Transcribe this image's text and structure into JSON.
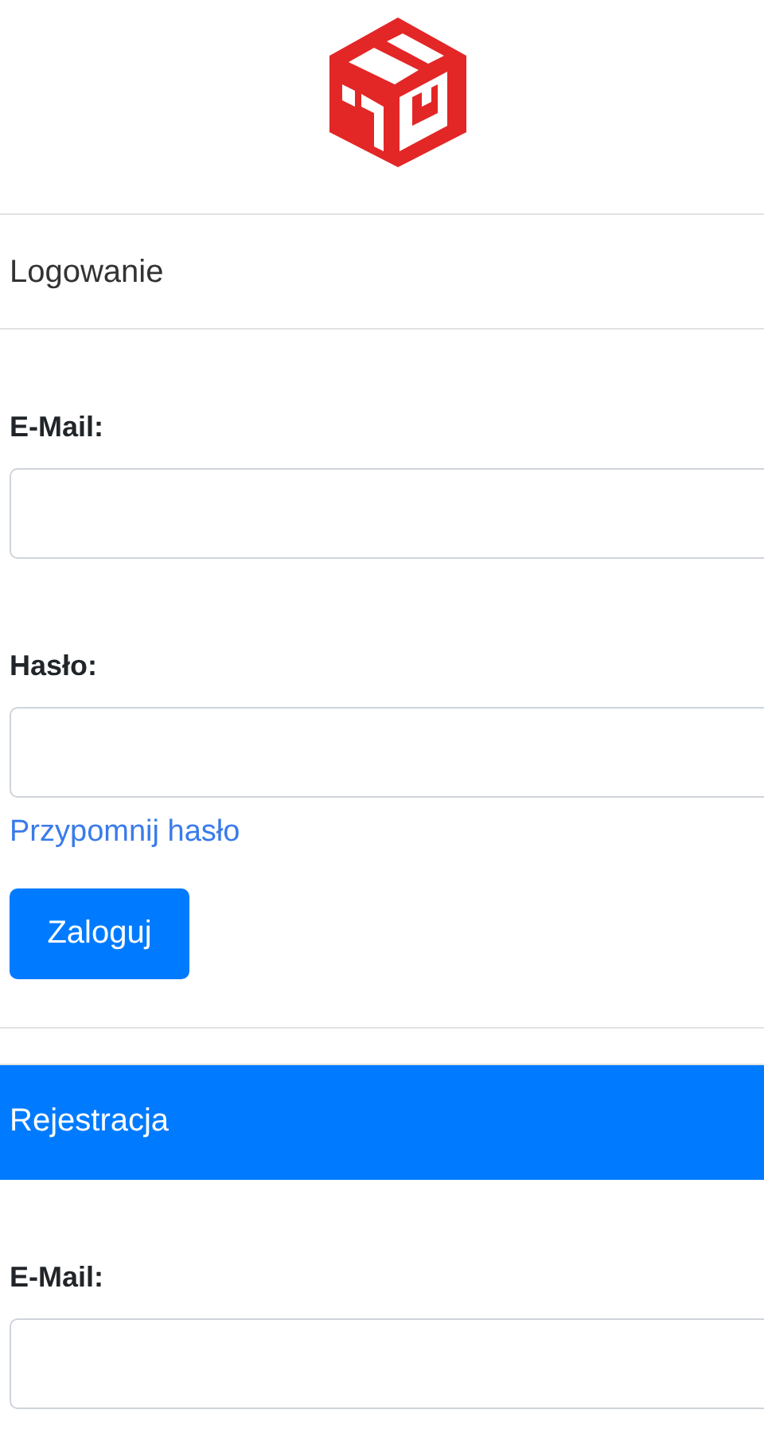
{
  "sections": [
    {
      "title": "Logowanie",
      "highlighted": false,
      "fields": [
        {
          "label": "E-Mail:"
        },
        {
          "label": "Hasło:"
        }
      ],
      "link": "Przypomnij hasło",
      "button": "Zaloguj"
    },
    {
      "title": "Rejestracja",
      "highlighted": true,
      "fields": [
        {
          "label": "E-Mail:"
        }
      ]
    }
  ]
}
